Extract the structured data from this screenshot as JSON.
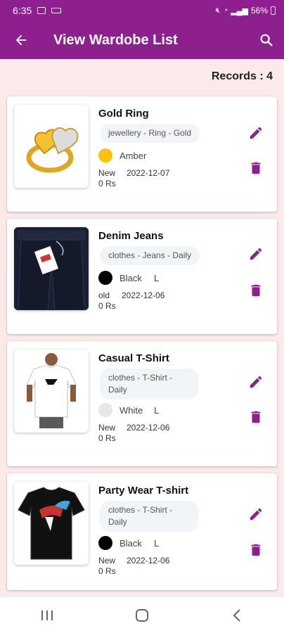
{
  "status_bar": {
    "time": "6:35",
    "battery": "56%"
  },
  "app_bar": {
    "title": "View Wardobe List"
  },
  "records_label": "Records : 4",
  "items": [
    {
      "name": "Gold Ring",
      "tags": "jewellery - Ring - Gold",
      "color_name": "Amber",
      "color_hex": "#ffc107",
      "size": "",
      "condition": "New",
      "date": "2022-12-07",
      "price": "0 Rs",
      "image": "gold-ring-image"
    },
    {
      "name": "Denim Jeans",
      "tags": "clothes - Jeans - Daily",
      "color_name": "Black",
      "color_hex": "#000000",
      "size": "L",
      "condition": "old",
      "date": "2022-12-06",
      "price": "0 Rs",
      "image": "denim-jeans-image"
    },
    {
      "name": "Casual T-Shirt",
      "tags": "clothes - T-Shirt - Daily",
      "color_name": "White",
      "color_hex": "#e6e6e6",
      "size": "L",
      "condition": "New",
      "date": "2022-12-06",
      "price": "0 Rs",
      "image": "white-tshirt-image"
    },
    {
      "name": "Party Wear T-shirt",
      "tags": "clothes - T-Shirt - Daily",
      "color_name": "Black",
      "color_hex": "#000000",
      "size": "L",
      "condition": "New",
      "date": "2022-12-06",
      "price": "0 Rs",
      "image": "black-tshirt-image"
    }
  ],
  "colors": {
    "primary": "#8e1f8e",
    "background": "#fce9e9",
    "accent_icon": "#8e1f8e"
  }
}
